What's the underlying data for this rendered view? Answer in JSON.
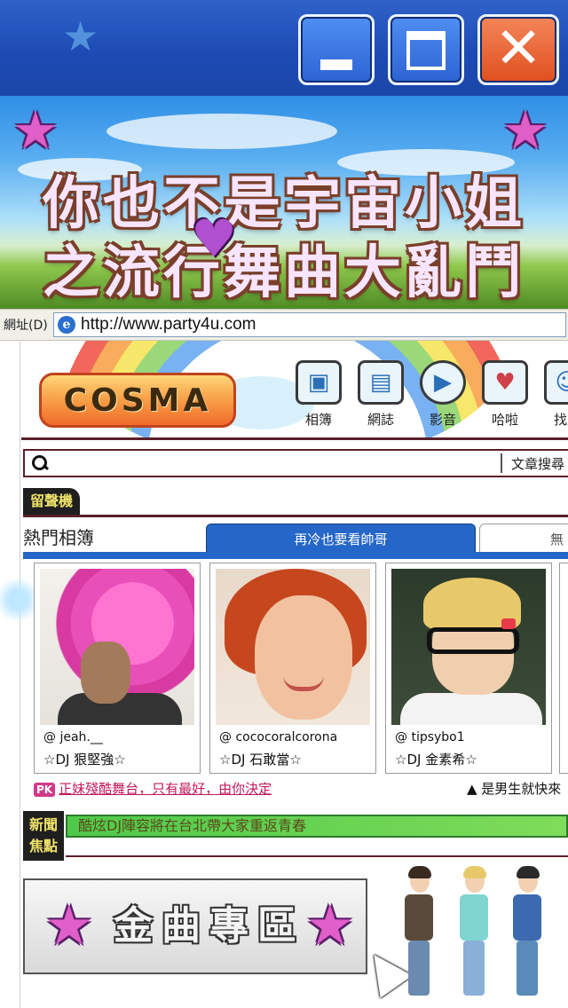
{
  "window": {
    "controls": {
      "minimize_icon": "minimize-icon",
      "maximize_icon": "maximize-icon",
      "close_icon": "close-x-icon",
      "close_glyph": "✕"
    }
  },
  "banner": {
    "line1": "你也不是宇宙小姐",
    "line2": "之流行舞曲大亂鬥",
    "heart_glyph": "♥",
    "star_glyph": "★"
  },
  "address_bar": {
    "label": "網址(D)",
    "url": "http://www.party4u.com",
    "icon_glyph": "e"
  },
  "site": {
    "logo": "COSMA",
    "nav": [
      {
        "label": "相簿",
        "icon": "photo-album-icon",
        "glyph": "▣"
      },
      {
        "label": "網誌",
        "icon": "blog-icon",
        "glyph": "▤"
      },
      {
        "label": "影音",
        "icon": "video-play-icon",
        "glyph": "▶"
      },
      {
        "label": "哈啦",
        "icon": "chat-icon",
        "glyph": "♥"
      },
      {
        "label": "找朋",
        "icon": "find-friend-icon",
        "glyph": "☺"
      }
    ],
    "search": {
      "placeholder": "",
      "label": "文章搜尋"
    },
    "guestbook": "留聲機",
    "albums": {
      "title": "熱門相簿",
      "active_tab": "再冷也要看帥哥",
      "second_tab": "無"
    },
    "cards": [
      {
        "handle": "@ jeah.__",
        "dj": "☆DJ 狠堅強☆"
      },
      {
        "handle": "@ cococoralcorona",
        "dj": "☆DJ 石敢當☆"
      },
      {
        "handle": "@ tipsybo1",
        "dj": "☆DJ 金素希☆"
      }
    ],
    "pk": {
      "badge": "PK",
      "text": "正妹殘酷舞台，只有最好，由你決定"
    },
    "pk_right": "▲ 是男生就快來",
    "news": {
      "label_line1": "新聞",
      "label_line2": "焦點",
      "headline": "酷炫DJ陣容將在台北帶大家重返青春"
    },
    "gold_zone": {
      "title": "金曲專區"
    }
  }
}
